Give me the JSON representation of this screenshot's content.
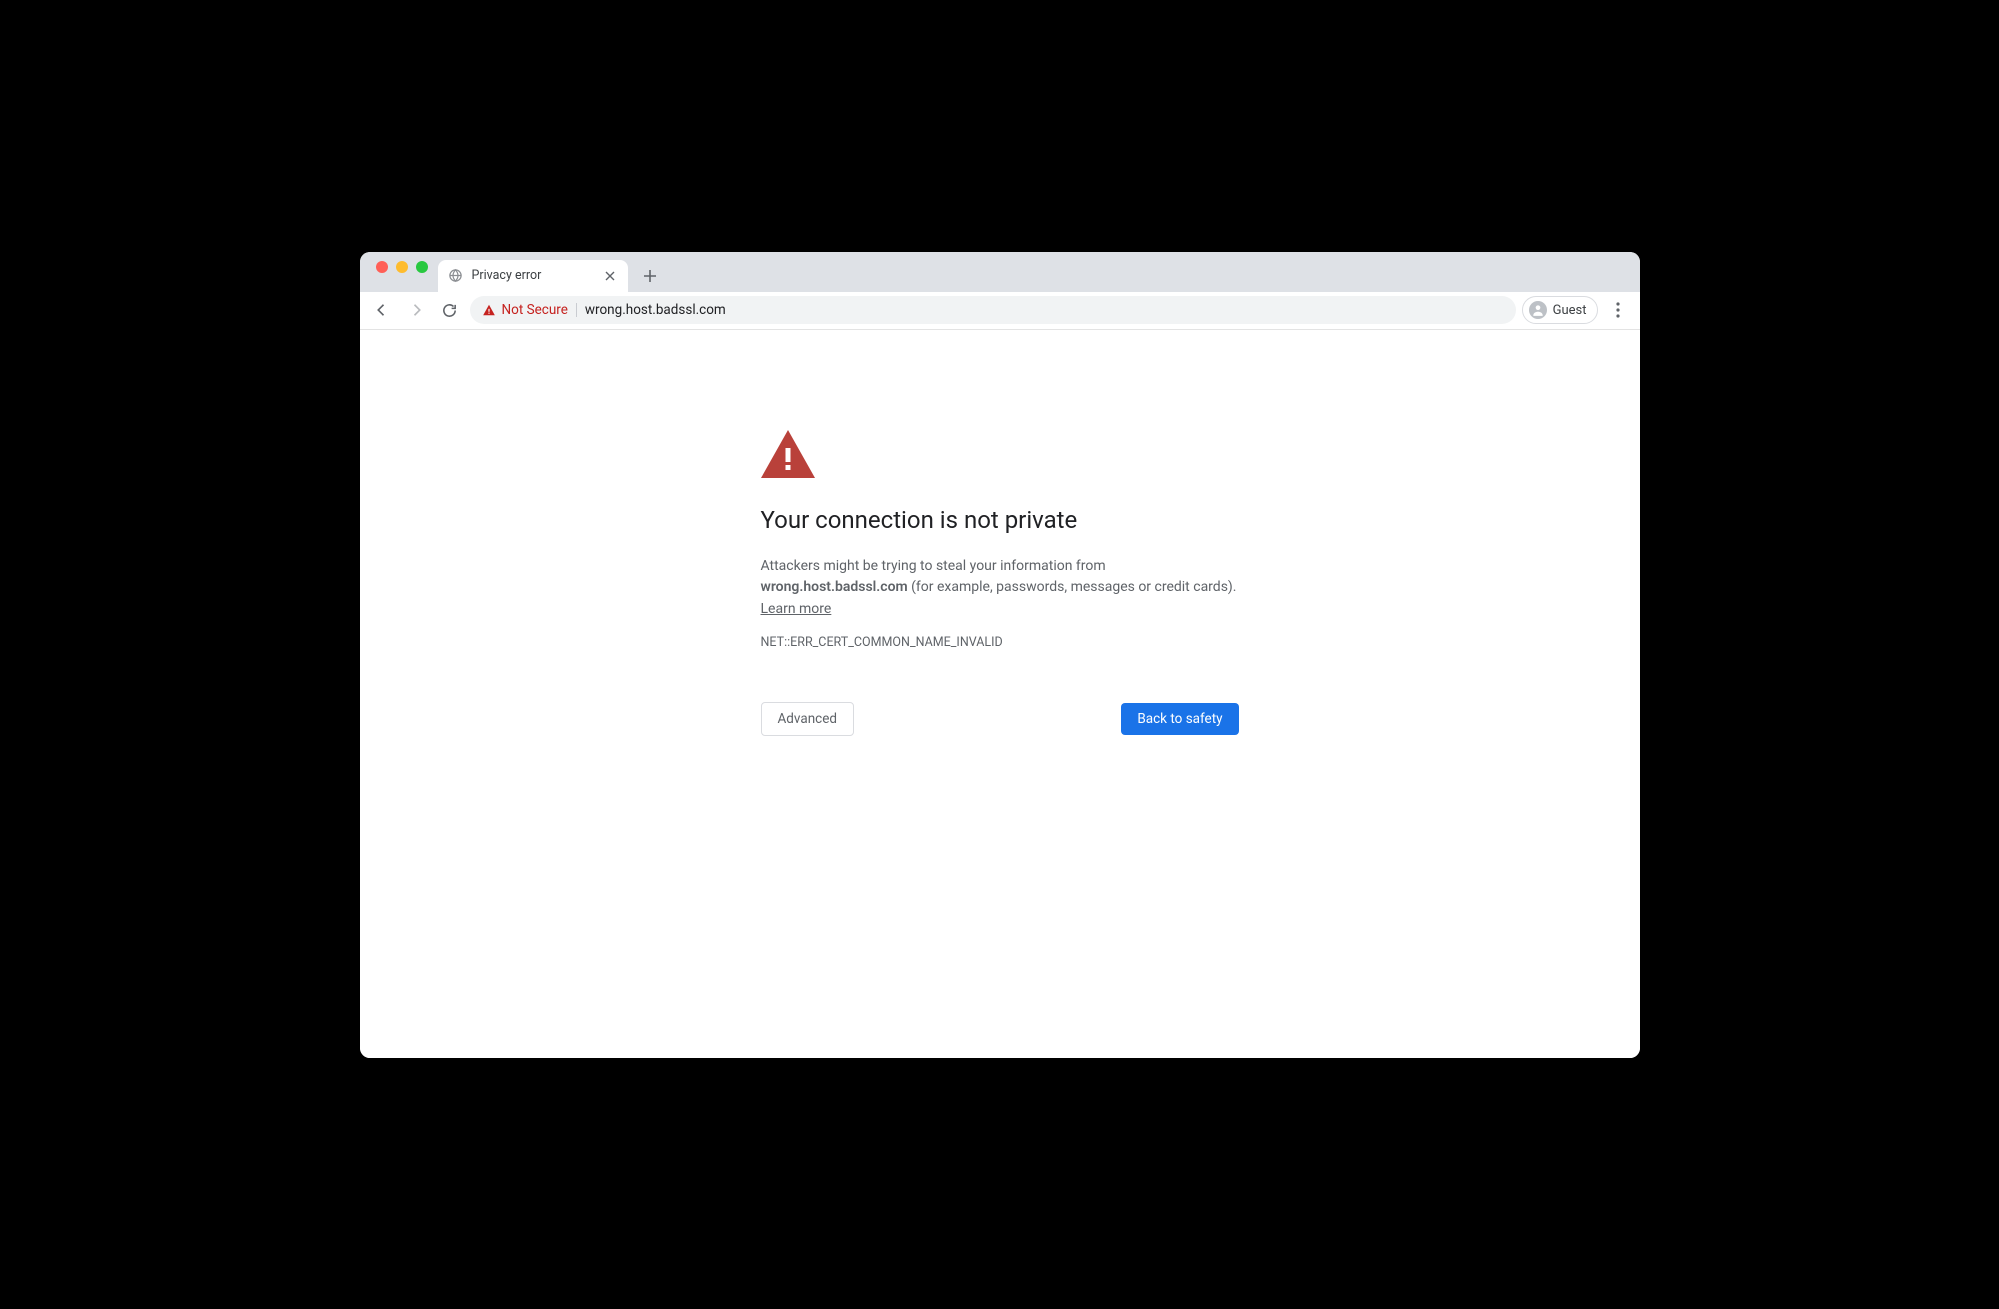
{
  "tab": {
    "title": "Privacy error"
  },
  "toolbar": {
    "security_label": "Not Secure",
    "url": "wrong.host.badssl.com",
    "profile_label": "Guest"
  },
  "interstitial": {
    "headline": "Your connection is not private",
    "body_pre": "Attackers might be trying to steal your information from ",
    "body_host": "wrong.host.badssl.com",
    "body_post": " (for example, passwords, messages or credit cards). ",
    "learn_more": "Learn more",
    "error_code": "NET::ERR_CERT_COMMON_NAME_INVALID",
    "advanced_label": "Advanced",
    "back_label": "Back to safety"
  }
}
